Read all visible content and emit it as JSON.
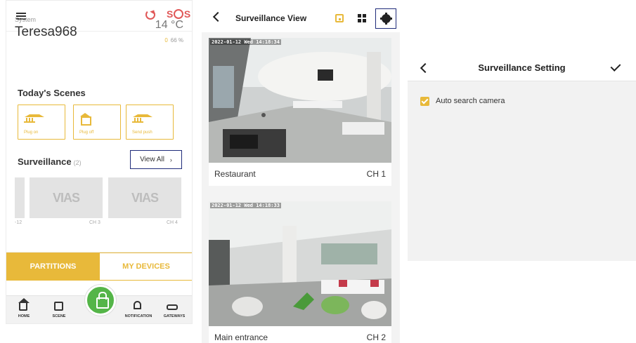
{
  "home": {
    "system_label": "System",
    "system_name": "Teresa968",
    "temperature": "14 °C",
    "humidity_value": "66 %",
    "humidity_icon": "0",
    "sos_label": "S",
    "sos_label2": "S",
    "scenes_title": "Today's Scenes",
    "scenes": [
      {
        "label": "Plug on",
        "icon": "bank-icon"
      },
      {
        "label": "Plug off",
        "icon": "home-gear-icon"
      },
      {
        "label": "Send push",
        "icon": "bank-icon"
      }
    ],
    "surveillance_title": "Surveillance",
    "surveillance_count": "(2)",
    "view_all_label": "View All",
    "view_all_chevron": "›",
    "cameras": [
      {
        "logo": "VIAS",
        "label": "CH 3"
      },
      {
        "logo": "VIAS",
        "label": "CH 4"
      }
    ],
    "partial_camera_label": "-12",
    "tabs": {
      "partitions": "PARTITIONS",
      "my_devices": "MY DEVICES"
    },
    "nav": {
      "home": "HOME",
      "scene": "SCENE",
      "notification": "NOTIFICATION",
      "gateways": "GATEWAYS"
    },
    "accent_color": "#e8b93a",
    "lock_color": "#54b548"
  },
  "surveillance_view": {
    "title": "Surveillance View",
    "cameras": [
      {
        "timestamp": "2022-01-12 Wed 14:18:34",
        "name": "Restaurant",
        "channel": "CH 1"
      },
      {
        "timestamp": "2022-01-12 Wed 14:18:33",
        "name": "Main entrance",
        "channel": "CH 2"
      }
    ]
  },
  "surveillance_setting": {
    "title": "Surveillance Setting",
    "auto_search_label": "Auto search camera",
    "auto_search_checked": true
  }
}
